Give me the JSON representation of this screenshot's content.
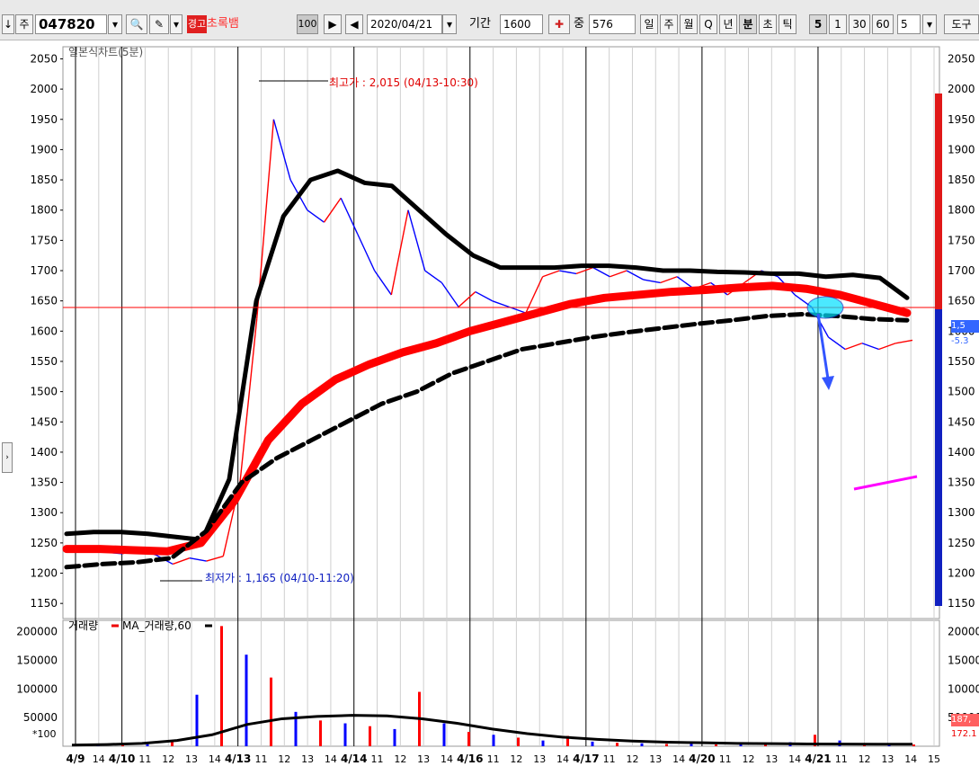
{
  "toolbar": {
    "arrow_down": "↓",
    "type_label": "주",
    "code": "047820",
    "warn_badge": "경고",
    "stock_name": "초록뱀",
    "percent_box": "100",
    "date": "2020/04/21",
    "period_label": "기간",
    "period_value": "1600",
    "count_label": "중",
    "count_value": "576",
    "periods": [
      "일",
      "주",
      "월",
      "Q",
      "년",
      "분",
      "초",
      "틱"
    ],
    "minutes": [
      "5",
      "1",
      "30",
      "60"
    ],
    "minute_input": "5",
    "extra_label": "도구"
  },
  "colors": {
    "price_up": "#ff0000",
    "price_down": "#0000ff",
    "ma_black": "#000000",
    "ma_red": "#ff0000",
    "highlight": "#00e0ff",
    "annotation_pink": "#ff00ff"
  },
  "chart_data": [
    {
      "type": "line",
      "title": "일본식차트(5분)",
      "y_ticks": [
        2050,
        2000,
        1950,
        1900,
        1850,
        1800,
        1750,
        1700,
        1650,
        1600,
        1550,
        1500,
        1450,
        1400,
        1350,
        1300,
        1250,
        1200,
        1150
      ],
      "ylim": [
        1125,
        2070
      ],
      "x_ticks": [
        "4/9",
        "14",
        "4/10",
        "11",
        "12",
        "13",
        "14",
        "4/13",
        "11",
        "12",
        "13",
        "14",
        "4/14",
        "11",
        "12",
        "13",
        "14",
        "4/16",
        "11",
        "12",
        "13",
        "14",
        "4/17",
        "11",
        "12",
        "13",
        "14",
        "4/20",
        "11",
        "12",
        "13",
        "14",
        "4/21",
        "11",
        "12",
        "13",
        "14",
        "15"
      ],
      "annotations": {
        "high": "최고가 : 2,015 (04/13-10:30)",
        "low": "최저가 : 1,165 (04/10-11:20)"
      },
      "right_labels": [
        "1,5",
        "-5.3"
      ],
      "series": [
        {
          "values": [
            1240,
            1245,
            1235,
            1232,
            1240,
            1230,
            1215,
            1225,
            1220,
            1228,
            1350,
            1620,
            1950,
            1850,
            1800,
            1780,
            1820,
            1760,
            1700,
            1660,
            1800,
            1700,
            1680,
            1640,
            1665,
            1650,
            1640,
            1630,
            1690,
            1700,
            1695,
            1705,
            1690,
            1700,
            1685,
            1680,
            1690,
            1670,
            1680,
            1660,
            1680,
            1700,
            1690,
            1660,
            1640,
            1590,
            1570,
            1580,
            1570,
            1580,
            1585
          ]
        },
        {
          "values": [
            1265,
            1268,
            1268,
            1265,
            1260,
            1255,
            1355,
            1650,
            1790,
            1850,
            1865,
            1845,
            1840,
            1800,
            1760,
            1725,
            1705,
            1705,
            1705,
            1708,
            1708,
            1705,
            1700,
            1700,
            1698,
            1697,
            1695,
            1695,
            1690,
            1693,
            1688,
            1655
          ]
        },
        {
          "values": [
            1240,
            1240,
            1238,
            1236,
            1250,
            1320,
            1420,
            1480,
            1520,
            1545,
            1565,
            1580,
            1600,
            1615,
            1630,
            1645,
            1655,
            1660,
            1665,
            1668,
            1672,
            1675,
            1670,
            1660,
            1645,
            1630
          ]
        },
        {
          "values": [
            1210,
            1215,
            1218,
            1225,
            1270,
            1350,
            1390,
            1420,
            1450,
            1480,
            1500,
            1530,
            1550,
            1570,
            1580,
            1590,
            1598,
            1605,
            1612,
            1618,
            1625,
            1628,
            1625,
            1620,
            1618
          ]
        }
      ]
    },
    {
      "type": "bar",
      "title": "거래량",
      "legend": "MA_거래량,60",
      "y_ticks": [
        200000,
        150000,
        100000,
        50000
      ],
      "ylim": [
        0,
        220000
      ],
      "scale_label": "*100",
      "right_labels": [
        "187,",
        "172.1"
      ],
      "values": [
        3000,
        4000,
        3000,
        5000,
        8000,
        90000,
        210000,
        160000,
        120000,
        60000,
        45000,
        40000,
        35000,
        30000,
        95000,
        40000,
        25000,
        20000,
        15000,
        10000,
        18000,
        8000,
        6000,
        5000,
        4000,
        6000,
        3000,
        5000,
        4000,
        7000,
        20000,
        10000,
        5000,
        4000,
        3000
      ],
      "ma_values": [
        2000,
        3000,
        5000,
        10000,
        20000,
        38000,
        48000,
        52000,
        54000,
        53000,
        48000,
        40000,
        30000,
        22000,
        16000,
        12000,
        9000,
        7000,
        6000,
        5000,
        4500,
        4000,
        3800,
        3600,
        3500
      ]
    }
  ]
}
